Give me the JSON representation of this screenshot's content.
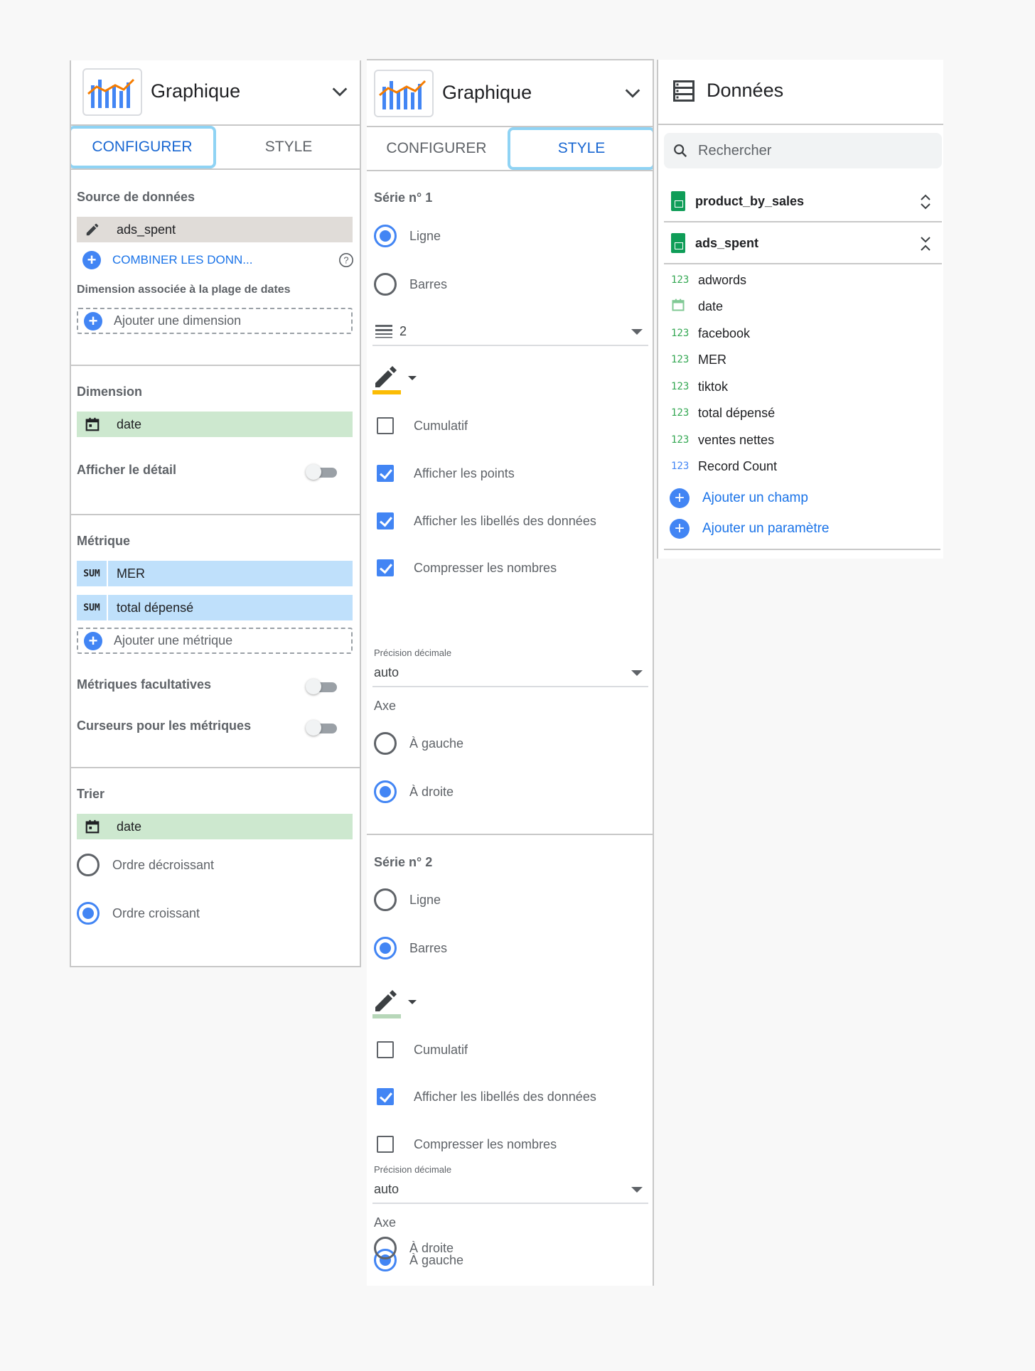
{
  "config_panel": {
    "header_title": "Graphique",
    "tabs": [
      "CONFIGURER",
      "STYLE"
    ],
    "data_source_label": "Source de données",
    "data_source_value": "ads_spent",
    "blend_label": "COMBINER LES DONN...",
    "date_range_dim_label": "Dimension associée à la plage de dates",
    "add_dimension": "Ajouter une dimension",
    "dimension_label": "Dimension",
    "dimension_value": "date",
    "drill_down_label": "Afficher le détail",
    "metric_label": "Métrique",
    "metrics": [
      {
        "agg": "SUM",
        "name": "MER"
      },
      {
        "agg": "SUM",
        "name": "total dépensé"
      }
    ],
    "add_metric": "Ajouter une métrique",
    "optional_metrics_label": "Métriques facultatives",
    "metric_sliders_label": "Curseurs pour les métriques",
    "sort_label": "Trier",
    "sort_value": "date",
    "sort_desc": "Ordre décroissant",
    "sort_asc": "Ordre croissant",
    "sort_selected": "asc"
  },
  "style_panel": {
    "header_title": "Graphique",
    "tabs": [
      "CONFIGURER",
      "STYLE"
    ],
    "series1": {
      "title": "Série n° 1",
      "type_line": "Ligne",
      "type_bars": "Barres",
      "type_selected": "line",
      "line_weight": "2",
      "color": "#fbbc04",
      "cumulative": "Cumulatif",
      "cumulative_checked": false,
      "show_points": "Afficher les points",
      "show_points_checked": true,
      "show_labels": "Afficher les libellés des données",
      "show_labels_checked": true,
      "compact_numbers": "Compresser les nombres",
      "compact_numbers_checked": true,
      "decimal_precision_label": "Précision décimale",
      "decimal_precision_value": "auto",
      "axis_label": "Axe",
      "axis_left": "À gauche",
      "axis_right": "À droite",
      "axis_selected": "right"
    },
    "series2": {
      "title": "Série n° 2",
      "type_line": "Ligne",
      "type_bars": "Barres",
      "type_selected": "bars",
      "color": "#b7d7b9",
      "cumulative": "Cumulatif",
      "cumulative_checked": false,
      "show_labels": "Afficher les libellés des données",
      "show_labels_checked": true,
      "compact_numbers": "Compresser les nombres",
      "compact_numbers_checked": false,
      "decimal_precision_label": "Précision décimale",
      "decimal_precision_value": "auto",
      "axis_label": "Axe",
      "axis_left": "À gauche",
      "axis_right": "À droite",
      "axis_selected": "left"
    }
  },
  "data_panel": {
    "title": "Données",
    "search_placeholder": "Rechercher",
    "sources": [
      "product_by_sales",
      "ads_spent"
    ],
    "fields": [
      {
        "icon": "123",
        "name": "adwords"
      },
      {
        "icon": "calendar-icon",
        "name": "date"
      },
      {
        "icon": "123",
        "name": "facebook"
      },
      {
        "icon": "123",
        "name": "MER"
      },
      {
        "icon": "123",
        "name": "tiktok"
      },
      {
        "icon": "123",
        "name": "total dépensé"
      },
      {
        "icon": "123",
        "name": "ventes nettes"
      },
      {
        "icon": "123",
        "name": "Record Count"
      }
    ],
    "add_field": "Ajouter un champ",
    "add_parameter": "Ajouter un paramètre"
  }
}
